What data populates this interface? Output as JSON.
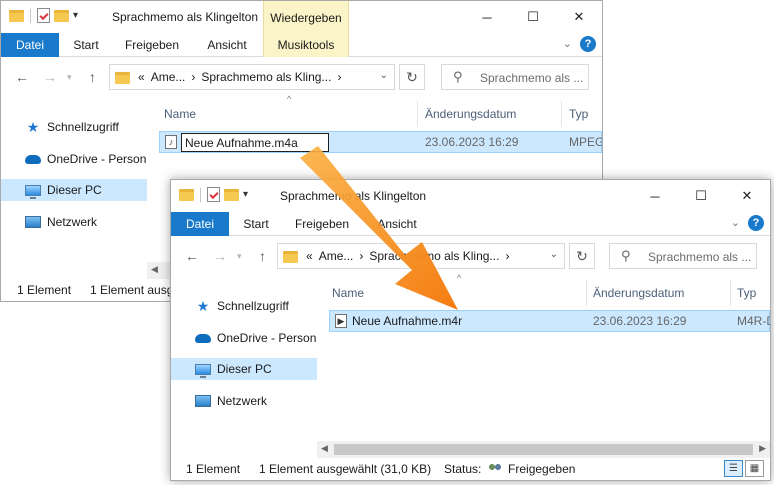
{
  "win1": {
    "title": "Sprachmemo als Klingelton",
    "context_tab": "Wiedergeben",
    "ribbon_tabs": [
      "Datei",
      "Start",
      "Freigeben",
      "Ansicht",
      "Musiktools"
    ],
    "breadcrumb": [
      "«",
      "Ame...",
      "›",
      "Sprachmemo als Kling...",
      "›"
    ],
    "search_placeholder": "Sprachmemo als ...",
    "columns": [
      "Name",
      "Änderungsdatum",
      "Typ"
    ],
    "file": {
      "rename_value": "Neue Aufnahme.m4a",
      "date": "23.06.2023 16:29",
      "type": "MPEG"
    },
    "nav": [
      "Schnellzugriff",
      "OneDrive - Person",
      "Dieser PC",
      "Netzwerk"
    ],
    "status": {
      "count": "1 Element",
      "selected": "1 Element ausg"
    }
  },
  "win2": {
    "title": "Sprachmemo als Klingelton",
    "ribbon_tabs": [
      "Datei",
      "Start",
      "Freigeben",
      "Ansicht"
    ],
    "breadcrumb": [
      "«",
      "Ame...",
      "›",
      "Sprachmemo als Kling...",
      "›"
    ],
    "search_placeholder": "Sprachmemo als ...",
    "columns": [
      "Name",
      "Änderungsdatum",
      "Typ"
    ],
    "file": {
      "name": "Neue Aufnahme.m4r",
      "date": "23.06.2023 16:29",
      "type": "M4R-D"
    },
    "nav": [
      "Schnellzugriff",
      "OneDrive - Person",
      "Dieser PC",
      "Netzwerk"
    ],
    "status": {
      "count": "1 Element",
      "selected": "1 Element ausgewählt (31,0 KB)",
      "status_label": "Status:",
      "status_value": "Freigegeben"
    }
  },
  "colors": {
    "accent": "#1979ca",
    "selection": "#cce8ff",
    "context_tab": "#fbf4c8",
    "arrow": "#f47c12"
  }
}
